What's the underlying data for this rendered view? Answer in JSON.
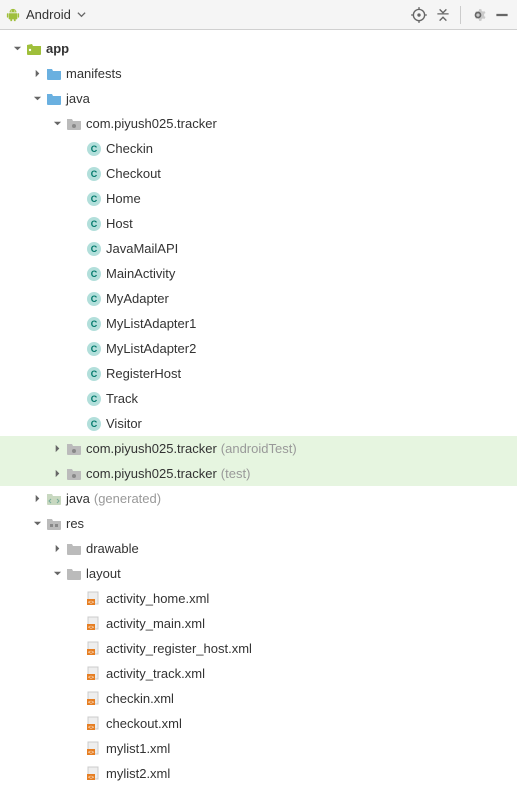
{
  "toolbar": {
    "view_selector": "Android"
  },
  "tree": {
    "app": {
      "label": "app"
    },
    "manifests": {
      "label": "manifests"
    },
    "java": {
      "label": "java"
    },
    "pkg_main": {
      "label": "com.piyush025.tracker"
    },
    "classes": [
      "Checkin",
      "Checkout",
      "Home",
      "Host",
      "JavaMailAPI",
      "MainActivity",
      "MyAdapter",
      "MyListAdapter1",
      "MyListAdapter2",
      "RegisterHost",
      "Track",
      "Visitor"
    ],
    "pkg_android_test": {
      "label": "com.piyush025.tracker",
      "suffix": "(androidTest)"
    },
    "pkg_test": {
      "label": "com.piyush025.tracker",
      "suffix": "(test)"
    },
    "java_generated": {
      "label": "java",
      "suffix": "(generated)"
    },
    "res": {
      "label": "res"
    },
    "drawable": {
      "label": "drawable"
    },
    "layout": {
      "label": "layout"
    },
    "layouts": [
      "activity_home.xml",
      "activity_main.xml",
      "activity_register_host.xml",
      "activity_track.xml",
      "checkin.xml",
      "checkout.xml",
      "mylist1.xml",
      "mylist2.xml"
    ]
  }
}
